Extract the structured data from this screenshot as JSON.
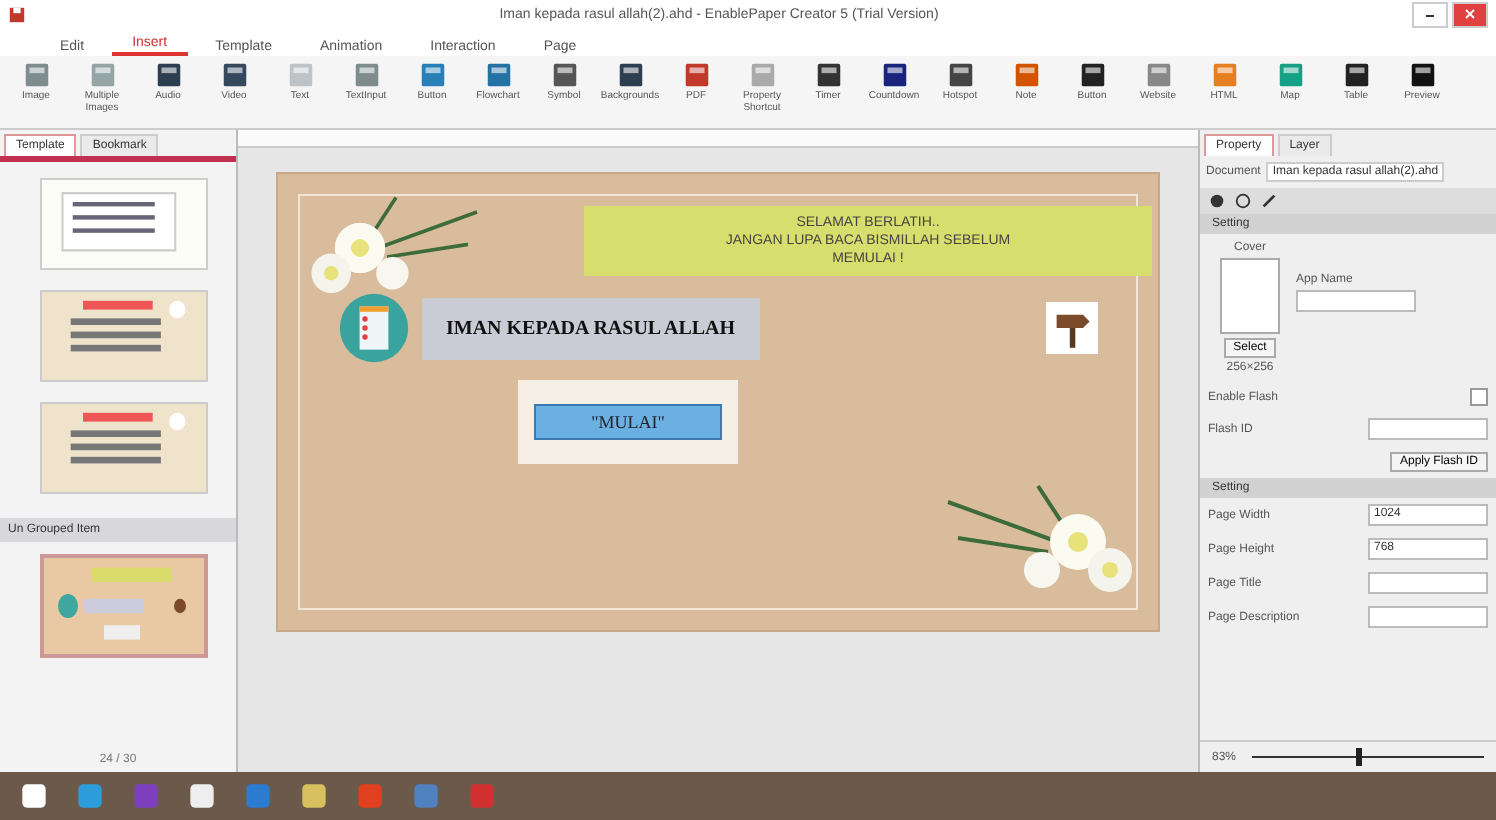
{
  "window": {
    "title": "Iman kepada rasul allah(2).ahd - EnablePaper Creator 5 (Trial Version)"
  },
  "tabs": [
    {
      "label": "Edit",
      "selected": false
    },
    {
      "label": "Insert",
      "selected": true
    },
    {
      "label": "Template",
      "selected": false
    },
    {
      "label": "Animation",
      "selected": false
    },
    {
      "label": "Interaction",
      "selected": false
    },
    {
      "label": "Page",
      "selected": false
    }
  ],
  "ribbon": [
    {
      "label": "Image"
    },
    {
      "label": "Multiple Images"
    },
    {
      "label": "Audio"
    },
    {
      "label": "Video"
    },
    {
      "label": "Text"
    },
    {
      "label": "TextInput"
    },
    {
      "label": "Button"
    },
    {
      "label": "Flowchart"
    },
    {
      "label": "Symbol"
    },
    {
      "label": "Backgrounds"
    },
    {
      "label": "PDF"
    },
    {
      "label": "Property Shortcut"
    },
    {
      "label": "Timer"
    },
    {
      "label": "Countdown"
    },
    {
      "label": "Hotspot"
    },
    {
      "label": "Note"
    },
    {
      "label": "Button"
    },
    {
      "label": "Website"
    },
    {
      "label": "HTML"
    },
    {
      "label": "Map"
    },
    {
      "label": "Table"
    },
    {
      "label": "Preview"
    }
  ],
  "left_panel": {
    "tabs": [
      {
        "label": "Template",
        "selected": true
      },
      {
        "label": "Bookmark",
        "selected": false
      }
    ],
    "group_title": "Un Grouped Item",
    "page_counter": "24 / 30"
  },
  "slide": {
    "greeting": [
      "SELAMAT BERLATIH..",
      "JANGAN LUPA BACA BISMILLAH SEBELUM",
      "MEMULAI !"
    ],
    "title": "IMAN KEPADA RASUL ALLAH",
    "start_button": "\"MULAI\""
  },
  "right_panel": {
    "tabs": [
      {
        "label": "Property",
        "selected": true
      },
      {
        "label": "Layer",
        "selected": false
      }
    ],
    "document_label": "Document",
    "document_value": "Iman kepada rasul allah(2).ahd",
    "section_1": "Setting",
    "cover_label": "Cover",
    "app_name_label": "App Name",
    "select_button": "Select",
    "cover_size": "256×256",
    "enable_flash_label": "Enable Flash",
    "enable_flash_checked": false,
    "flash_id_label": "Flash ID",
    "apply_button": "Apply Flash ID",
    "section_2": "Setting",
    "fields": [
      {
        "label": "Page Width",
        "value": "1024"
      },
      {
        "label": "Page Height",
        "value": "768"
      },
      {
        "label": "Page Title"
      },
      {
        "label": "Page Description"
      }
    ],
    "zoom": "83%",
    "zoom_slider": {
      "level": 0.45
    }
  }
}
